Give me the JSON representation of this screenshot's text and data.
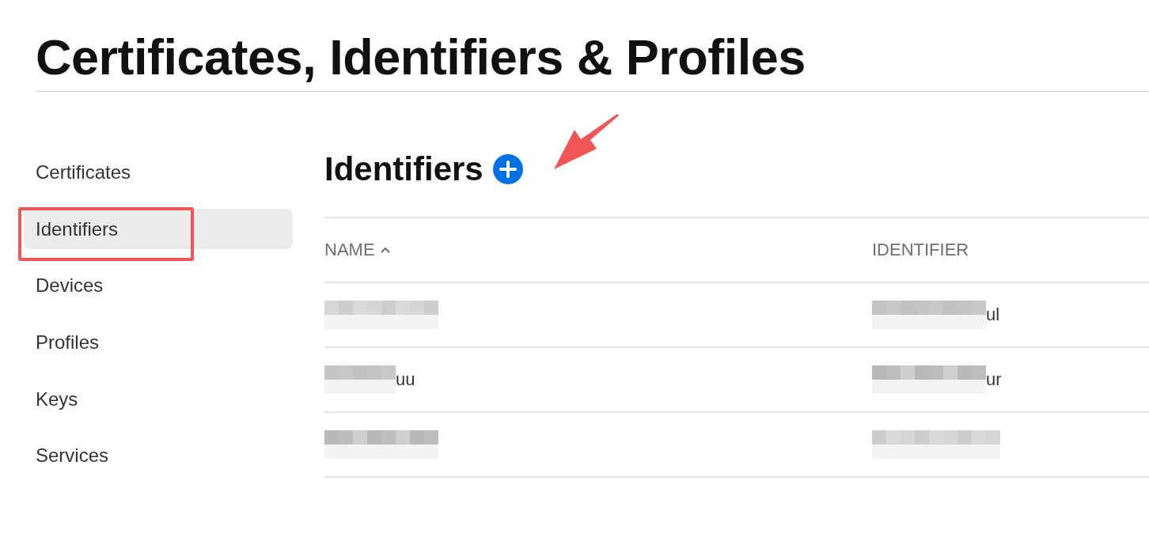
{
  "page_title": "Certificates, Identifiers & Profiles",
  "sidebar": {
    "items": [
      {
        "label": "Certificates",
        "selected": false
      },
      {
        "label": "Identifiers",
        "selected": true
      },
      {
        "label": "Devices",
        "selected": false
      },
      {
        "label": "Profiles",
        "selected": false
      },
      {
        "label": "Keys",
        "selected": false
      },
      {
        "label": "Services",
        "selected": false
      }
    ]
  },
  "section": {
    "title": "Identifiers"
  },
  "table": {
    "columns": [
      {
        "label": "NAME",
        "sorted": true
      },
      {
        "label": "IDENTIFIER"
      }
    ],
    "rows": [
      [
        {
          "redacted": true
        },
        {
          "redacted": true,
          "text": "ul"
        }
      ],
      [
        {
          "redacted": true,
          "text": "uu"
        },
        {
          "redacted": true,
          "text": "ur"
        }
      ],
      [
        {
          "redacted": true
        },
        {
          "redacted": true
        }
      ]
    ]
  },
  "annotations": {
    "highlight_box": true,
    "arrow": true
  }
}
